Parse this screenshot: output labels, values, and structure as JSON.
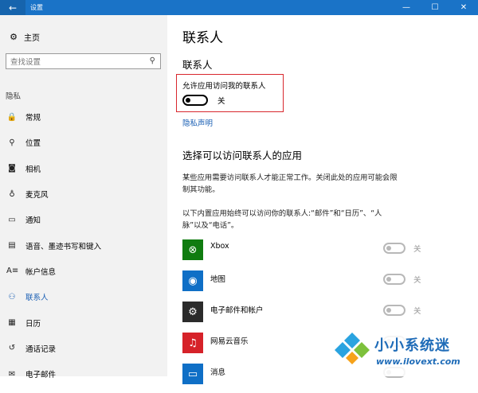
{
  "titlebar": {
    "back_icon": "←",
    "title": "设置",
    "minimize": "—",
    "maximize": "☐",
    "close": "✕"
  },
  "sidebar": {
    "home_label": "主页",
    "search_placeholder": "查找设置",
    "section_title": "隐私",
    "items": [
      {
        "label": "常规",
        "icon": "lock-icon",
        "glyph": "🔒"
      },
      {
        "label": "位置",
        "icon": "location-icon",
        "glyph": "⚲"
      },
      {
        "label": "相机",
        "icon": "camera-icon",
        "glyph": "◙"
      },
      {
        "label": "麦克风",
        "icon": "microphone-icon",
        "glyph": "♁"
      },
      {
        "label": "通知",
        "icon": "notification-icon",
        "glyph": "▭"
      },
      {
        "label": "语音、墨迹书写和键入",
        "icon": "speech-icon",
        "glyph": "▤"
      },
      {
        "label": "帐户信息",
        "icon": "account-info-icon",
        "glyph": "A≡"
      },
      {
        "label": "联系人",
        "icon": "contacts-icon",
        "glyph": "⚇",
        "active": true
      },
      {
        "label": "日历",
        "icon": "calendar-icon",
        "glyph": "▦"
      },
      {
        "label": "通话记录",
        "icon": "call-history-icon",
        "glyph": "↺"
      },
      {
        "label": "电子邮件",
        "icon": "email-icon",
        "glyph": "✉"
      }
    ]
  },
  "main": {
    "title": "联系人",
    "subtitle": "联系人",
    "allow_label": "允许应用访问我的联系人",
    "toggle_state": "关",
    "privacy_link": "隐私声明",
    "apps_title": "选择可以访问联系人的应用",
    "desc1": "某些应用需要访问联系人才能正常工作。关闭此处的应用可能会限制其功能。",
    "desc2": "以下内置应用始终可以访问你的联系人:“邮件”和“日历”、“人脉”以及“电话”。",
    "apps": [
      {
        "name": "Xbox",
        "state": "关",
        "color": "#107c10",
        "glyph": "⊗"
      },
      {
        "name": "地图",
        "state": "关",
        "color": "#0f6fc6",
        "glyph": "◉"
      },
      {
        "name": "电子邮件和帐户",
        "state": "关",
        "color": "#2b2b2b",
        "glyph": "⚙"
      },
      {
        "name": "网易云音乐",
        "state": "",
        "color": "#d62229",
        "glyph": "♫"
      },
      {
        "name": "消息",
        "state": "",
        "color": "#0f6fc6",
        "glyph": "▭"
      }
    ]
  },
  "watermark": {
    "text": "小小系统迷",
    "url": "www.ilovext.com"
  },
  "colors": {
    "accent": "#1a5fb4",
    "titlebar": "#1a73c7",
    "highlight_box": "#d8272d"
  }
}
